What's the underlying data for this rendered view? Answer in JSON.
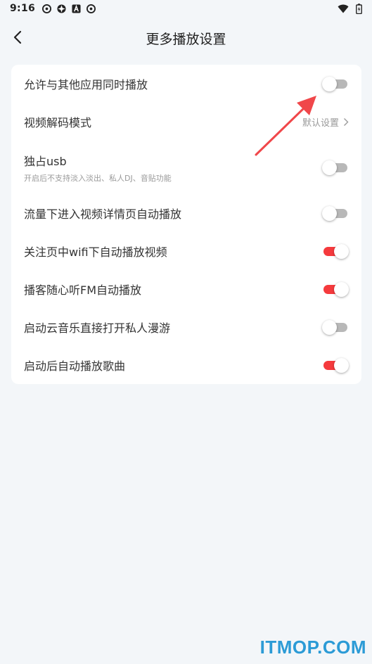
{
  "status": {
    "time": "9:16"
  },
  "header": {
    "title": "更多播放设置"
  },
  "settings": [
    {
      "label": "允许与其他应用同时播放",
      "type": "toggle",
      "on": false
    },
    {
      "label": "视频解码模式",
      "type": "link",
      "value": "默认设置"
    },
    {
      "label": "独占usb",
      "desc": "开启后不支持淡入淡出、私人DJ、音贴功能",
      "type": "toggle",
      "on": false
    },
    {
      "label": "流量下进入视频详情页自动播放",
      "type": "toggle",
      "on": false
    },
    {
      "label": "关注页中wifi下自动播放视频",
      "type": "toggle",
      "on": true
    },
    {
      "label": "播客随心听FM自动播放",
      "type": "toggle",
      "on": true
    },
    {
      "label": "启动云音乐直接打开私人漫游",
      "type": "toggle",
      "on": false
    },
    {
      "label": "启动后自动播放歌曲",
      "type": "toggle",
      "on": true
    }
  ],
  "colors": {
    "toggle_on": "#f53a3d",
    "toggle_off": "#b8b8b8",
    "annotation_arrow": "#f0474a",
    "watermark": "#2c9bd6"
  },
  "watermark": "ITMOP.COM"
}
